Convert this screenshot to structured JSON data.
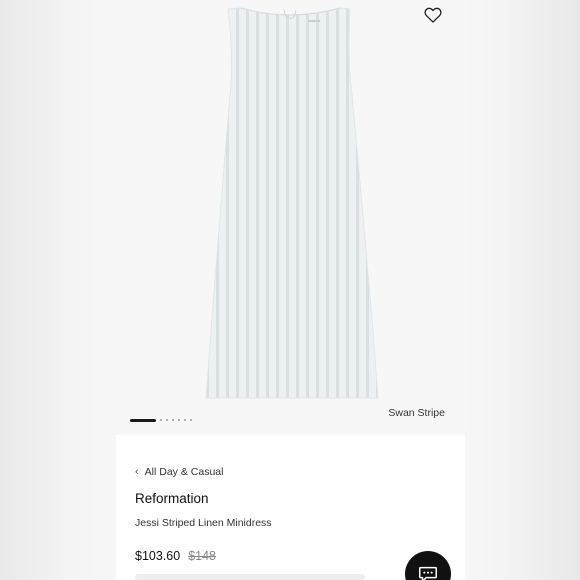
{
  "product": {
    "color_name": "Swan Stripe",
    "breadcrumb": "All Day & Casual",
    "brand": "Reformation",
    "name": "Jessi Striped Linen Minidress",
    "price": "$103.60",
    "original_price": "$148"
  },
  "gallery": {
    "image_count": 7,
    "active_index": 0
  },
  "icons": {
    "favorite": "heart-outline-icon",
    "breadcrumb_back": "chevron-left-icon",
    "chat": "chat-bubble-icon"
  },
  "colors": {
    "panel_bg": "#ffffff",
    "page_bg": "#f2f2f2",
    "text": "#111111",
    "muted": "#888888",
    "chat_button": "#111111"
  }
}
